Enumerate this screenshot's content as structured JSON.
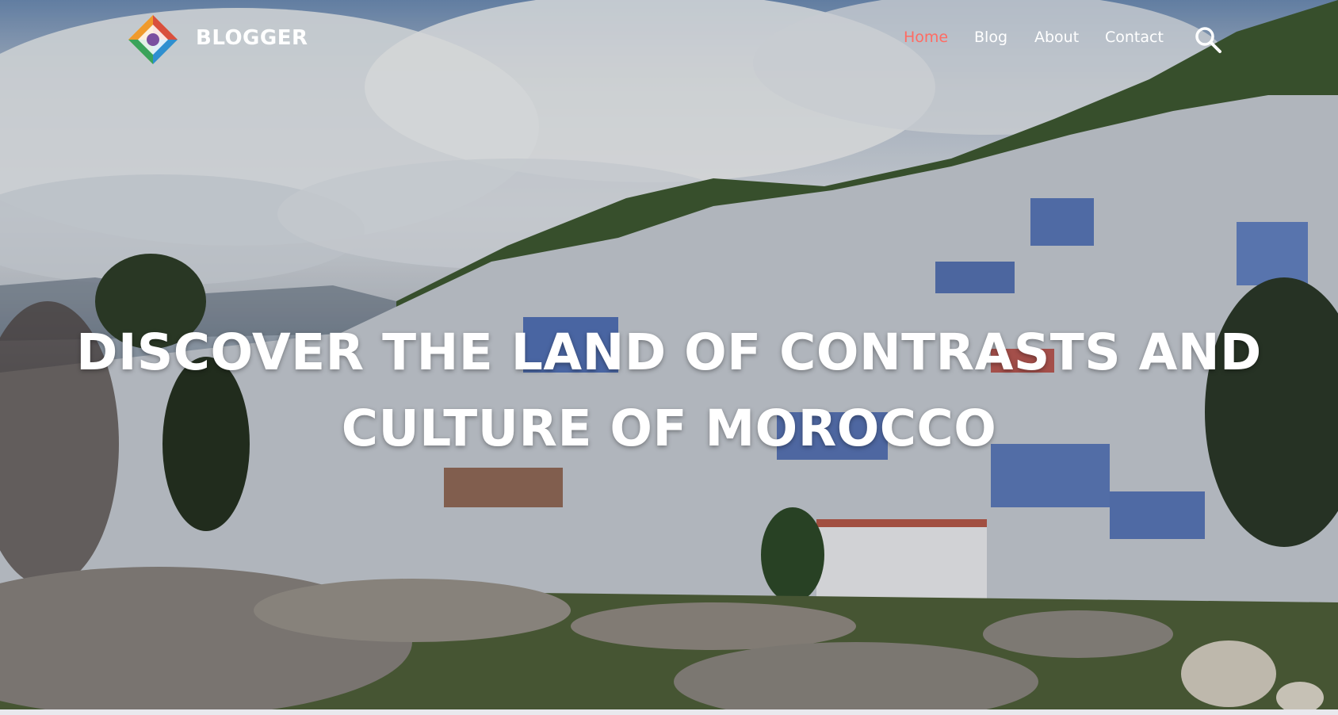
{
  "brand": {
    "name": "BLOGGER",
    "logo_icon": "diamond-logo-icon"
  },
  "nav": {
    "items": [
      {
        "label": "Home",
        "active": true
      },
      {
        "label": "Blog",
        "active": false
      },
      {
        "label": "About",
        "active": false
      },
      {
        "label": "Contact",
        "active": false
      }
    ],
    "active_color": "#ff6b63",
    "search_icon": "search-icon"
  },
  "hero": {
    "headline_line1": "DISCOVER THE LAND OF CONTRASTS AND",
    "headline_line2": "CULTURE OF MOROCCO",
    "background": "Chefchaouen blue town hillside photo"
  }
}
